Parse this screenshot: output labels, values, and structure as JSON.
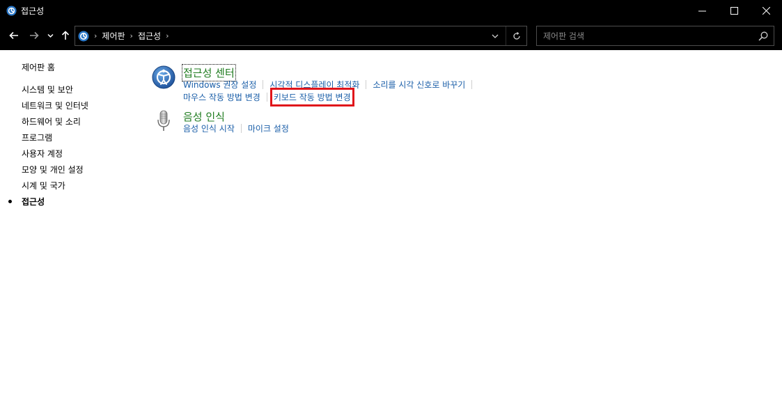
{
  "window": {
    "title": "접근성"
  },
  "address": {
    "breadcrumbs": [
      "제어판",
      "접근성"
    ]
  },
  "search": {
    "placeholder": "제어판 검색"
  },
  "sidebar": {
    "home": "제어판 홈",
    "items": [
      {
        "label": "시스템 및 보안"
      },
      {
        "label": "네트워크 및 인터넷"
      },
      {
        "label": "하드웨어 및 소리"
      },
      {
        "label": "프로그램"
      },
      {
        "label": "사용자 계정"
      },
      {
        "label": "모양 및 개인 설정"
      },
      {
        "label": "시계 및 국가"
      },
      {
        "label": "접근성",
        "current": true
      }
    ]
  },
  "main": {
    "categories": [
      {
        "title": "접근성 센터",
        "icon": "ease-of-access-icon",
        "links_row1": [
          "Windows 권장 설정",
          "시각적 디스플레이 최적화",
          "소리를 시각 신호로 바꾸기"
        ],
        "links_row2": [
          "마우스 작동 방법 변경",
          "키보드 작동 방법 변경"
        ],
        "highlighted_link": "키보드 작동 방법 변경"
      },
      {
        "title": "음성 인식",
        "icon": "microphone-icon",
        "links_row1": [
          "음성 인식 시작",
          "마이크 설정"
        ]
      }
    ]
  },
  "colors": {
    "category_title": "#1e7b1e",
    "task_link": "#1a5ea8",
    "highlight": "#e0151b",
    "chrome": "#000000"
  }
}
